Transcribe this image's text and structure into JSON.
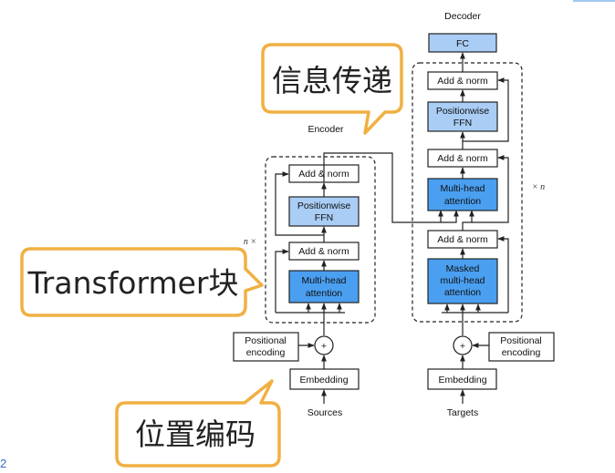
{
  "encoder": {
    "title": "Encoder",
    "add_norm_top": "Add & norm",
    "ffn_line1": "Positionwise",
    "ffn_line2": "FFN",
    "add_norm_bottom": "Add & norm",
    "attention_line1": "Multi-head",
    "attention_line2": "attention",
    "repeat_label": "n ×"
  },
  "decoder": {
    "title": "Decoder",
    "fc": "FC",
    "add_norm_top": "Add & norm",
    "ffn_line1": "Positionwise",
    "ffn_line2": "FFN",
    "add_norm_middle": "Add & norm",
    "attention_line1": "Multi-head",
    "attention_line2": "attention",
    "add_norm_bottom": "Add & norm",
    "masked_line1": "Masked",
    "masked_line2": "multi-head",
    "masked_line3": "attention",
    "repeat_label": "× n"
  },
  "inputs": {
    "left_positional_line1": "Positional",
    "left_positional_line2": "encoding",
    "right_positional_line1": "Positional",
    "right_positional_line2": "encoding",
    "plus_symbol": "+",
    "left_embedding": "Embedding",
    "right_embedding": "Embedding",
    "sources": "Sources",
    "targets": "Targets"
  },
  "callouts": {
    "message_passing": "信息传递",
    "transformer_block": "Transformer块",
    "positional_encoding": "位置编码"
  },
  "corner": {
    "page_fragment": "2"
  },
  "colors": {
    "light_blue_box": "#a9cdf5",
    "blue_box": "#4a9ff0",
    "callout_border": "#f0b042"
  }
}
